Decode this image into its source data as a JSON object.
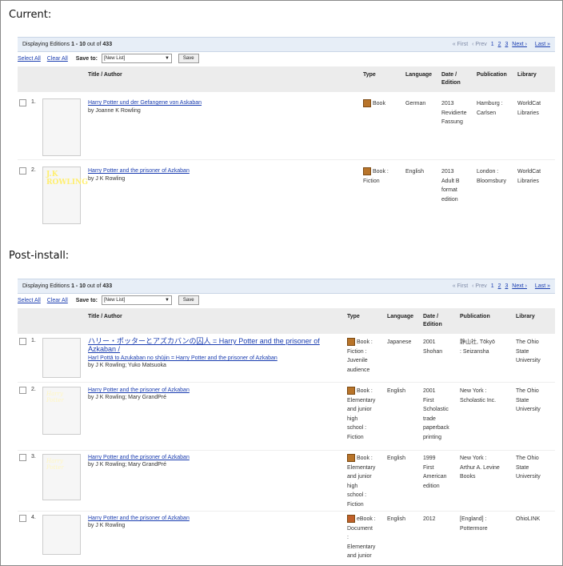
{
  "current": {
    "label": "Current:",
    "display": {
      "prefix": "Displaying Editions ",
      "range": "1 - 10",
      "suffix": " out of ",
      "total": "433"
    },
    "pager": {
      "first": "« First",
      "prev": "‹ Prev",
      "pages": [
        "1",
        "2",
        "3"
      ],
      "next": "Next ›",
      "last": "Last »"
    },
    "toolbar": {
      "select_all": "Select All",
      "clear_all": "Clear All",
      "save_to": "Save to:",
      "list_value": "[New List]",
      "save": "Save"
    },
    "headers": {
      "title": "Title / Author",
      "type": "Type",
      "language": "Language",
      "date": "Date / Edition",
      "publication": "Publication",
      "library": "Library"
    },
    "rows": [
      {
        "num": "1.",
        "title": "Harry Potter und der Gefangene von Askaban",
        "author": "by Joanne K Rowling",
        "type": [
          "Book"
        ],
        "language": "German",
        "date": [
          "2013",
          "Revidierte",
          "Fassung"
        ],
        "publication": [
          "Hamburg :",
          "Carlsen"
        ],
        "library": [
          "WorldCat",
          "Libraries"
        ]
      },
      {
        "num": "2.",
        "title": "Harry Potter and the prisoner of Azkaban",
        "author": "by J K Rowling",
        "type": [
          "Book :",
          "Fiction"
        ],
        "language": "English",
        "date": [
          "2013",
          "Adult B",
          "format",
          "edition"
        ],
        "publication": [
          "London :",
          "Bloomsbury"
        ],
        "library": [
          "WorldCat",
          "Libraries"
        ],
        "cover_text": "J.K ROWLING"
      }
    ]
  },
  "post": {
    "label": "Post-install:",
    "display": {
      "prefix": "Displaying Editions ",
      "range": "1 - 10",
      "suffix": " out of ",
      "total": "433"
    },
    "pager": {
      "first": "« First",
      "prev": "‹ Prev",
      "pages": [
        "1",
        "2",
        "3"
      ],
      "next": "Next ›",
      "last": "Last »"
    },
    "toolbar": {
      "select_all": "Select All",
      "clear_all": "Clear All",
      "save_to": "Save to:",
      "list_value": "[New List]",
      "save": "Save"
    },
    "headers": {
      "title": "Title / Author",
      "type": "Type",
      "language": "Language",
      "date": "Date / Edition",
      "publication": "Publication",
      "library": "Library"
    },
    "rows": [
      {
        "num": "1.",
        "title": "ハリー・ポッターとアズカバンの囚人 = Harry Potter and the prisoner of Azkaban /",
        "subtitle": "Harī Pottā to Azukaban no shūjin = Harry Potter and the prisoner of Azkaban",
        "author": "by J K Rowling; Yuko Matsuoka",
        "type": [
          "Book :",
          "Fiction :",
          "Juvenile",
          "audience"
        ],
        "language": "Japanese",
        "date": [
          "2001",
          "Shohan"
        ],
        "publication": [
          "静山社, Tōkyō",
          ": Seizansha"
        ],
        "library": [
          "The Ohio",
          "State",
          "University"
        ]
      },
      {
        "num": "2.",
        "title": "Harry Potter and the prisoner of Azkaban",
        "author": "by J K Rowling; Mary GrandPré",
        "type": [
          "Book :",
          "Elementary",
          "and junior",
          "high",
          "school :",
          "Fiction"
        ],
        "language": "English",
        "date": [
          "2001",
          "First",
          "Scholastic",
          "trade",
          "paperback",
          "printing"
        ],
        "publication": [
          "New York :",
          "Scholastic Inc."
        ],
        "library": [
          "The Ohio",
          "State",
          "University"
        ],
        "cover_text": "Harry Potter"
      },
      {
        "num": "3.",
        "title": "Harry Potter and the prisoner of Azkaban",
        "author": "by J K Rowling; Mary GrandPré",
        "type": [
          "Book :",
          "Elementary",
          "and junior",
          "high",
          "school :",
          "Fiction"
        ],
        "language": "English",
        "date": [
          "1999",
          "First",
          "American",
          "edition"
        ],
        "publication": [
          "New York :",
          "Arthur A. Levine",
          "Books"
        ],
        "library": [
          "The Ohio",
          "State",
          "University"
        ],
        "cover_text": "Harry Potter"
      },
      {
        "num": "4.",
        "title": "Harry Potter and the prisoner of Azkaban",
        "author": "by J K Rowling",
        "type": [
          "eBook :",
          "Document",
          ":",
          "Elementary",
          "and junior"
        ],
        "language": "English",
        "date": [
          "2012"
        ],
        "publication": [
          "[England] :",
          "Pottermore"
        ],
        "library": [
          "OhioLINK"
        ]
      }
    ]
  }
}
